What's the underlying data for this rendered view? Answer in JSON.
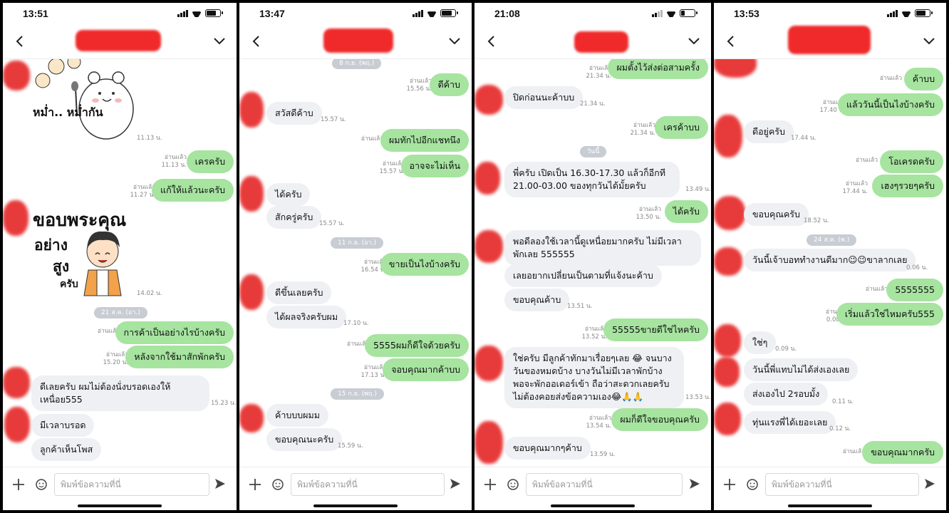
{
  "common": {
    "input_placeholder": "พิมพ์ข้อความที่นี่",
    "read_label": "อ่านแล้ว",
    "colors": {
      "outgoing": "#a6e4a0",
      "incoming": "#eef0f3",
      "date_pill": "#c8ccd3",
      "redaction": "#f02a2a"
    }
  },
  "screens": [
    {
      "time": "13:51",
      "sticker1_text": "หม่ำ.. หม่ำกัน",
      "sticker1_time": "11.13 น.",
      "m1": {
        "read": "อ่านแล้ว",
        "time": "11.13 น.",
        "text": "เครครับ"
      },
      "m2": {
        "read": "อ่านแล้ว",
        "time": "11.27 น.",
        "text": "แก้ให้แล้วนะครับ"
      },
      "sticker2_line1": "ขอบพระคุณ",
      "sticker2_line2": "อย่าง",
      "sticker2_line3": "สูง",
      "sticker2_line4": "ครับ",
      "sticker2_time": "14.02 น.",
      "date": "21 ส.ค. (อา.)",
      "m3": {
        "read": "อ่านแล้ว",
        "text": "การค้าเป็นอย่างไรบ้างครับ"
      },
      "m4": {
        "read": "อ่านแล้ว",
        "time": "15.20 น.",
        "text": "หลังจากใช้มาสักพักครับ"
      },
      "m5": {
        "text": "ดีเลยครับ ผมไม่ต้องนั่งบรอดเองให้เหนื่อย555",
        "time": "15.23 น."
      },
      "m6": {
        "text": "มีเวลาบรอด"
      },
      "m7": {
        "text": "ลูกค้าเห็นโพส"
      }
    },
    {
      "time": "13:47",
      "date1": "8 ก.ย. (พฤ.)",
      "m1": {
        "read": "อ่านแล้ว",
        "time": "15.56 น.",
        "text": "ดีค้าบ"
      },
      "m2": {
        "text": "สวัสดีค้าบ",
        "time": "15.57 น."
      },
      "m3": {
        "read": "อ่านแล้ว",
        "text": "ผมทักไปอีกแชทนึง"
      },
      "m4": {
        "read": "อ่านแล้ว",
        "time": "15.57 น.",
        "text": "อาจจะไม่เห็น"
      },
      "m5": {
        "text": "ได้ครับ"
      },
      "m6": {
        "text": "สักครู่ครับ",
        "time": "15.57 น."
      },
      "date2": "11 ก.ย. (อา.)",
      "m7": {
        "read": "อ่านแล้ว",
        "time": "16.54 น.",
        "text": "ขายเป็นไงบ้างครับ"
      },
      "m8": {
        "text": "ดีขึ้นเลยครับ"
      },
      "m9": {
        "text": "ได้ผลจริงครับผม",
        "time": "17.10 น."
      },
      "m10": {
        "read": "อ่านแล้ว",
        "text": "5555ผมก็ดีใจด้วยครับ"
      },
      "m11": {
        "read": "อ่านแล้ว",
        "time": "17.13 น.",
        "text": "จอบคุณมากค้าบบ"
      },
      "date3": "15 ก.ย. (พฤ.)",
      "m12": {
        "text": "ค้าบบบผมม"
      },
      "m13": {
        "text": "ขอบคุณนะครับ",
        "time": "15.59 น."
      }
    },
    {
      "time": "21:08",
      "m1": {
        "read": "อ่านแล้ว",
        "time": "21.34 น.",
        "text": "ผมตั้งไว้ส่งต่อสามครั้ง"
      },
      "m2": {
        "text": "ปิดก่อนนะค้าบบ",
        "time": "21.34 น."
      },
      "m3": {
        "read": "อ่านแล้ว",
        "time": "21.34 น.",
        "text": "เครค้าบบ"
      },
      "date": "วันนี้",
      "m4": {
        "text": "พี่ครับ เปิดเป็น 16.30-17.30 แล้วก็อีกที 21.00-03.00 ของทุกวันได้มั้ยครับ",
        "time": "13.49 น."
      },
      "m5": {
        "read": "อ่านแล้ว",
        "time": "13.50 น.",
        "text": "ได้ครับ"
      },
      "m6": {
        "text": "พอดีลองใช้เวลานี้ดูเหนื่อยมากครับ ไม่มีเวลาพักเลย 555555"
      },
      "m7": {
        "text": "เลยอยากเปลี่ยนเป็นตามที่แจ้งนะค้าบ"
      },
      "m8": {
        "text": "ขอบคุณค้าบ",
        "time": "13.51 น."
      },
      "m9": {
        "read": "อ่านแล้ว",
        "time": "13.52 น.",
        "text": "55555ขายดีใช่ไหครับ"
      },
      "m10": {
        "text": "ใช่ครับ มีลูกค้าทักมาเรื่อยๆเลย 😂 จนบางวันของหมดบ้าง บางวันไม่มีเวลาพักบ้าง พอจะพักออเดอร์เข้า ถือว่าสะดวกเลยครับไม่ต้องคอยส่งข้อความเอง😂🙏🙏",
        "time": "13.53 น."
      },
      "m11": {
        "read": "อ่านแล้ว",
        "time": "13.54 น.",
        "text": "ผมก็ดีใจขอบคุณครับ"
      },
      "m12": {
        "text": "ขอบคุณมากๆค้าบ",
        "time": "13.59 น."
      }
    },
    {
      "time": "13:53",
      "m1": {
        "read": "อ่านแล้ว",
        "text": "ค้าบบ"
      },
      "m2": {
        "read": "อ่านแล้ว",
        "time": "17.40 น.",
        "text": "แล้ววันนี้เป็นไงบ้างครับ"
      },
      "m3": {
        "text": "ดีอยู่ครับ",
        "time": "17.44 น."
      },
      "m4": {
        "read": "อ่านแล้ว",
        "text": "โอเครดครับ"
      },
      "m5": {
        "read": "อ่านแล้ว",
        "time": "17.44 น.",
        "text": "เฮงๆรวยๆครับ"
      },
      "m6": {
        "text": "ขอบคุณครับ",
        "time": "18.52 น."
      },
      "date": "24 ส.ค. (พ.)",
      "m7": {
        "text": "วันนี้เจ้าบอททำงานดีมาก😉😉ขาลากเลย",
        "time": "0.06 น."
      },
      "m8": {
        "read": "อ่านแล้ว",
        "text": "5555555"
      },
      "m9": {
        "read": "อ่านแล้ว",
        "time": "0.08 น.",
        "text": "เริ่มแล้วใช่ไหมครับ555"
      },
      "m10": {
        "text": "ใช่ๆ",
        "time": "0.09 น."
      },
      "m11": {
        "text": "วันนี้พี่แทบไม่ได้ส่งเองเลย"
      },
      "m12": {
        "text": "ส่งเองไป 2รอบมั้ง",
        "time": "0.11 น."
      },
      "m13": {
        "text": "ทุ่นแรงพี่ได้เยอะเลย",
        "time": "0.12 น."
      },
      "m14": {
        "read": "อ่านแล้ว",
        "text": "ขอบคุณมากครับ"
      }
    }
  ]
}
